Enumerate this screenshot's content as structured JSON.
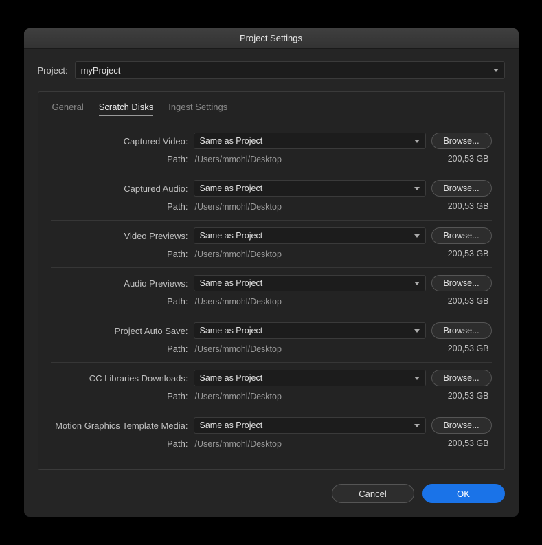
{
  "title": "Project Settings",
  "project": {
    "label": "Project:",
    "value": "myProject"
  },
  "tabs": {
    "general": "General",
    "scratch": "Scratch Disks",
    "ingest": "Ingest Settings"
  },
  "labels": {
    "path": "Path:",
    "browse": "Browse..."
  },
  "sections": [
    {
      "label": "Captured Video:",
      "option": "Same as Project",
      "path": "/Users/mmohl/Desktop",
      "size": "200,53 GB"
    },
    {
      "label": "Captured Audio:",
      "option": "Same as Project",
      "path": "/Users/mmohl/Desktop",
      "size": "200,53 GB"
    },
    {
      "label": "Video Previews:",
      "option": "Same as Project",
      "path": "/Users/mmohl/Desktop",
      "size": "200,53 GB"
    },
    {
      "label": "Audio Previews:",
      "option": "Same as Project",
      "path": "/Users/mmohl/Desktop",
      "size": "200,53 GB"
    },
    {
      "label": "Project Auto Save:",
      "option": "Same as Project",
      "path": "/Users/mmohl/Desktop",
      "size": "200,53 GB"
    },
    {
      "label": "CC Libraries Downloads:",
      "option": "Same as Project",
      "path": "/Users/mmohl/Desktop",
      "size": "200,53 GB"
    },
    {
      "label": "Motion Graphics Template Media:",
      "option": "Same as Project",
      "path": "/Users/mmohl/Desktop",
      "size": "200,53 GB"
    }
  ],
  "footer": {
    "cancel": "Cancel",
    "ok": "OK"
  }
}
